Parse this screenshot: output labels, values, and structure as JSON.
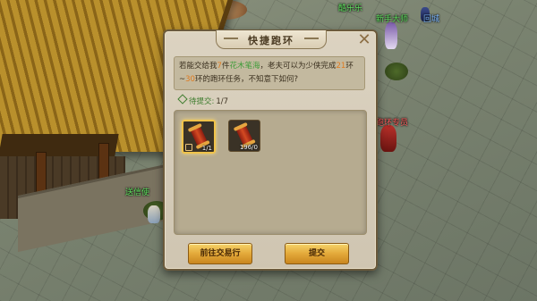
{
  "world": {
    "npc_names": [
      {
        "text": "酷乐乐",
        "color": "green"
      },
      {
        "text": "新手大师",
        "color": "green"
      },
      {
        "text": "回城",
        "color": "blue"
      },
      {
        "text": "跑环专员",
        "color": "red"
      },
      {
        "text": "送信使",
        "color": "green"
      }
    ]
  },
  "dialog": {
    "title": "快捷跑环",
    "close_icon": "close-icon",
    "message": {
      "p1": "若能交给我",
      "count": "7",
      "p2": "件",
      "item": "花木笔海",
      "p3": "，老夫可以为少侠完成",
      "ring_a": "21",
      "p4": "环~",
      "ring_b": "30",
      "p5": "环的跑环任务，不知意下如何?"
    },
    "pending_label": "待提交:",
    "pending_count": "1/7",
    "items": [
      {
        "name": "花木笔海",
        "icon": "red-scroll-icon",
        "quantity": "1/1",
        "selected": true,
        "locked": true
      },
      {
        "name": "花木笔海",
        "icon": "red-scroll-icon",
        "quantity": "196/0",
        "selected": false,
        "locked": false
      }
    ],
    "buttons": {
      "trade_label": "前往交易行",
      "submit_label": "提交"
    }
  },
  "colors": {
    "highlight_green": "#3f9c3a",
    "highlight_orange": "#e07a1e",
    "button_gold": "#e3a93a",
    "selected_border": "#f0c34a"
  }
}
